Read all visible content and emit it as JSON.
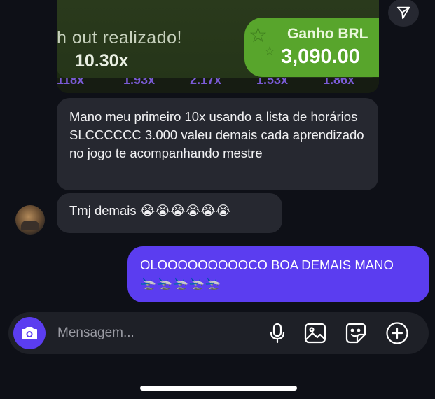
{
  "shared_image": {
    "cashout_text": "h out realizado!",
    "multiplier": "10.30x",
    "win_label": "Ganho BRL",
    "win_value": "3,090.00",
    "strip_text": [
      "118x",
      "1.93x",
      "2.17x",
      "1.53x",
      "1.86x"
    ]
  },
  "messages": {
    "incoming_1": "Mano meu primeiro 10x usando a lista de horários SLCCCCCC 3.000 valeu demais cada aprendizado no jogo te acompanhando mestre",
    "incoming_2": "Tmj demais 😭😭😭😭😭😭",
    "outgoing_1_line1": "OLOOOOOOOOOCO BOA DEMAIS MANO",
    "outgoing_1_line2": "🛬🛬🛬🛬🛬"
  },
  "composer": {
    "placeholder": "Mensagem..."
  },
  "icons": {
    "share": "paper-plane-icon",
    "camera": "camera-icon",
    "mic": "microphone-icon",
    "gallery": "image-icon",
    "sticker": "sticker-icon",
    "add": "plus-circle-icon"
  },
  "colors": {
    "accent": "#5b3df0",
    "bubble_in": "#262830",
    "background": "#0e1017",
    "win_green": "#58a52c"
  }
}
